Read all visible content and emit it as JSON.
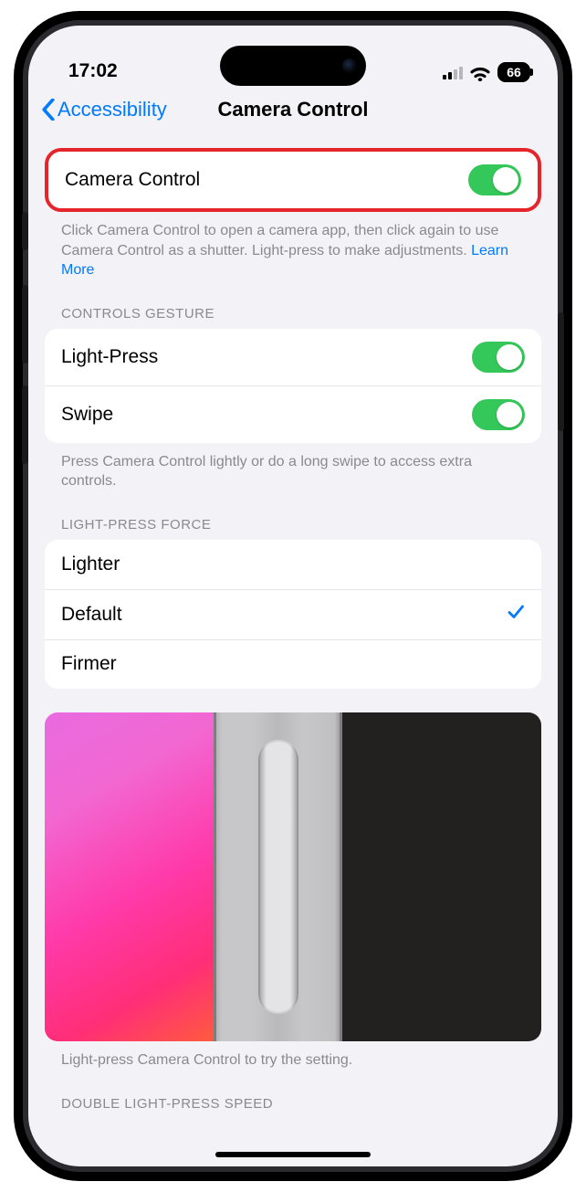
{
  "status": {
    "time": "17:02",
    "battery": "66"
  },
  "nav": {
    "back": "Accessibility",
    "title": "Camera Control"
  },
  "main_toggle": {
    "label": "Camera Control",
    "description_pre": "Click Camera Control to open a camera app, then click again to use Camera Control as a shutter. Light-press to make adjustments. ",
    "learn_more": "Learn More"
  },
  "gesture": {
    "header": "Controls Gesture",
    "rows": {
      "light_press": "Light-Press",
      "swipe": "Swipe"
    },
    "footer": "Press Camera Control lightly or do a long swipe to access extra controls."
  },
  "force": {
    "header": "Light-Press Force",
    "lighter": "Lighter",
    "default": "Default",
    "firmer": "Firmer"
  },
  "preview_caption": "Light-press Camera Control to try the setting.",
  "next_section": "Double Light-Press Speed"
}
